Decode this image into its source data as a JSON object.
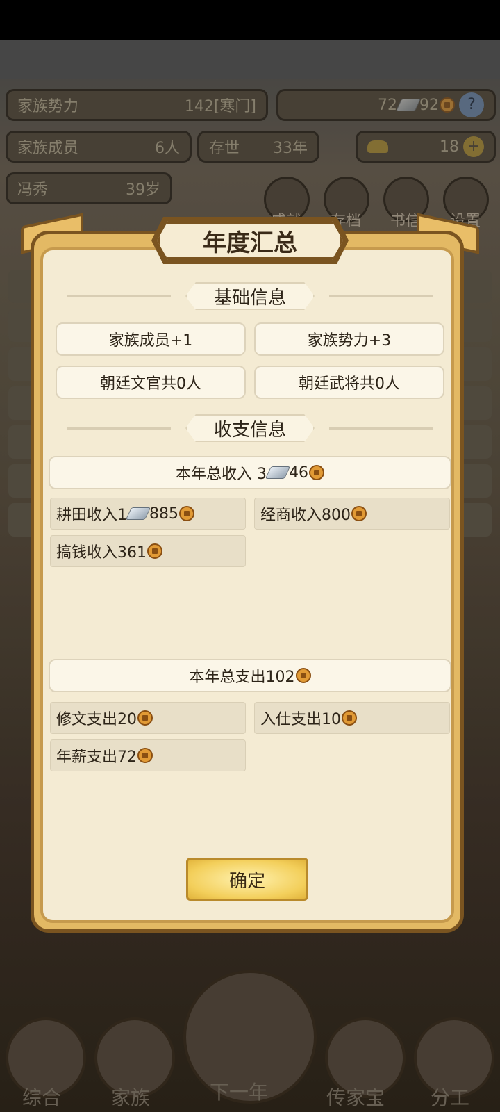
{
  "background": {
    "clan_power_label": "家族势力",
    "clan_power_value": "142[寒门]",
    "silver": "72",
    "copper": "92",
    "members_label": "家族成员",
    "members_value": "6人",
    "alive_label": "存世",
    "alive_value": "33年",
    "gold": "18",
    "person_name": "冯秀",
    "person_age": "39岁",
    "round_buttons": [
      "成就",
      "存档",
      "书信",
      "设置"
    ],
    "nav": [
      "综合",
      "家族",
      "下一年",
      "传家宝",
      "分工"
    ]
  },
  "dialog": {
    "title": "年度汇总",
    "basic_section": "基础信息",
    "basic": [
      "家族成员+1",
      "家族势力+3",
      "朝廷文官共0人",
      "朝廷武将共0人"
    ],
    "finance_section": "收支信息",
    "income_total_prefix": "本年总收入 3",
    "income_total_suffix": "46",
    "income_items": {
      "farm_prefix": "耕田收入1",
      "farm_suffix": "885",
      "trade": "经商收入800",
      "money": "搞钱收入361"
    },
    "expense_total": "本年总支出102",
    "expense_items": {
      "study": "修文支出20",
      "office": "入仕支出10",
      "salary": "年薪支出72"
    },
    "confirm_label": "确定"
  },
  "colors": {
    "frame_gold": "#e3b964",
    "panel_cream": "#f4ebd3",
    "frame_brown": "#7a5420",
    "coin": "#e19a35"
  }
}
